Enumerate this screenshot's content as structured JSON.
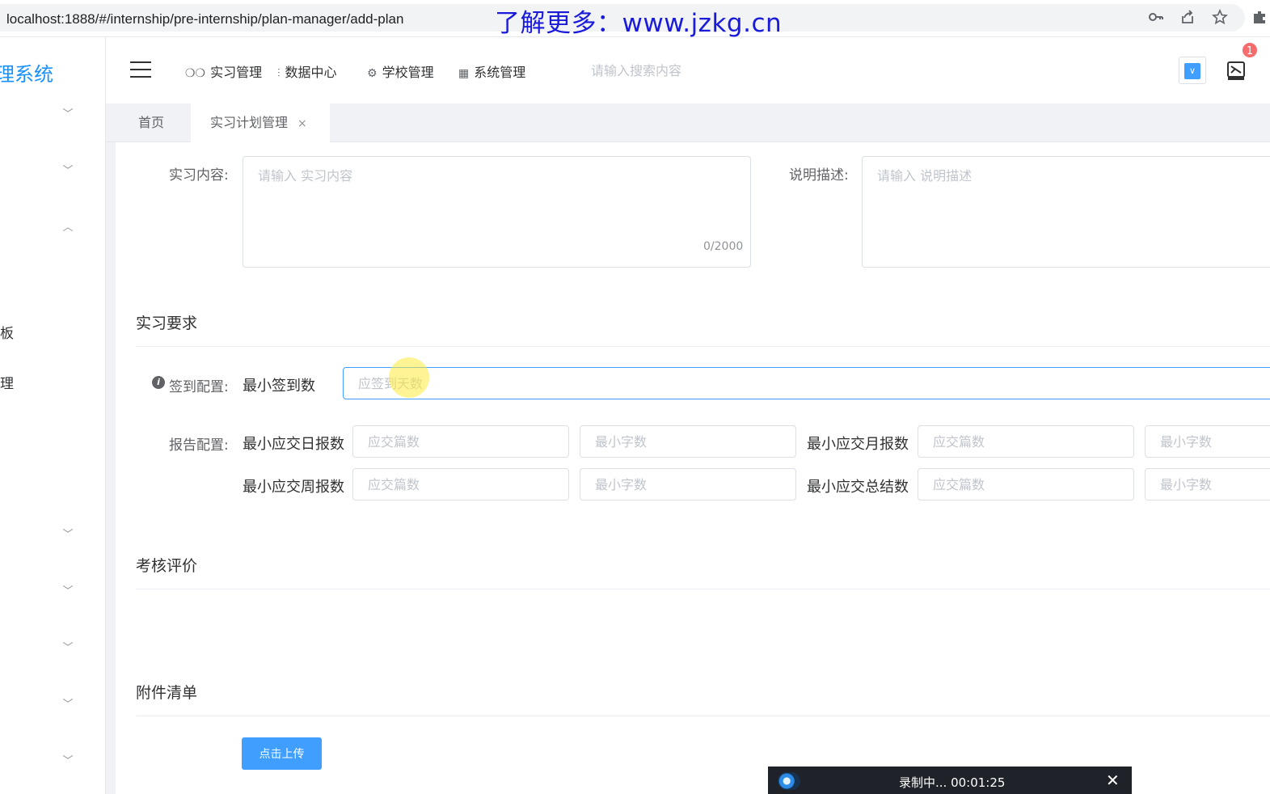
{
  "browser": {
    "url": "localhost:1888/#/internship/pre-internship/plan-manager/add-plan",
    "watermark": "了解更多：www.jzkg.cn",
    "icons": [
      "key-icon",
      "share-icon",
      "star-icon",
      "extensions-icon"
    ]
  },
  "sidebar": {
    "brand": "理系统",
    "fragments": [
      "板",
      "理"
    ]
  },
  "topnav": {
    "items": [
      {
        "icon": "glasses-icon",
        "glyph": "ᕱ",
        "label": "实习管理"
      },
      {
        "icon": "chart-icon",
        "glyph": "⫶",
        "label": "数据中心"
      },
      {
        "icon": "gear-icon",
        "glyph": "⚙",
        "label": "学校管理"
      },
      {
        "icon": "grid-icon",
        "glyph": "▦",
        "label": "系统管理"
      }
    ],
    "search_placeholder": "请输入搜索内容",
    "badge_count": "1"
  },
  "tabs": {
    "home": "首页",
    "current": "实习计划管理",
    "close_glyph": "×"
  },
  "form": {
    "content_label": "实习内容:",
    "content_placeholder": "请输入 实习内容",
    "content_counter": "0/2000",
    "desc_label": "说明描述:",
    "desc_placeholder": "请输入 说明描述",
    "requirements_title": "实习要求",
    "signin_label": "签到配置:",
    "min_signin_label": "最小签到数",
    "min_signin_placeholder": "应签到天数",
    "report_label": "报告配置:",
    "reports": {
      "daily_label": "最小应交日报数",
      "weekly_label": "最小应交周报数",
      "monthly_label": "最小应交月报数",
      "summary_label": "最小应交总结数",
      "count_placeholder": "应交篇数",
      "words_placeholder": "最小字数"
    },
    "evaluation_title": "考核评价",
    "attachments_title": "附件清单",
    "upload_label": "点击上传"
  },
  "recorder": {
    "status": "录制中... 00:01:25",
    "close_glyph": "✕"
  },
  "colors": {
    "primary": "#409eff",
    "brand": "#1890ff",
    "badge": "#f56c6c",
    "watermark": "#1a1adb"
  }
}
